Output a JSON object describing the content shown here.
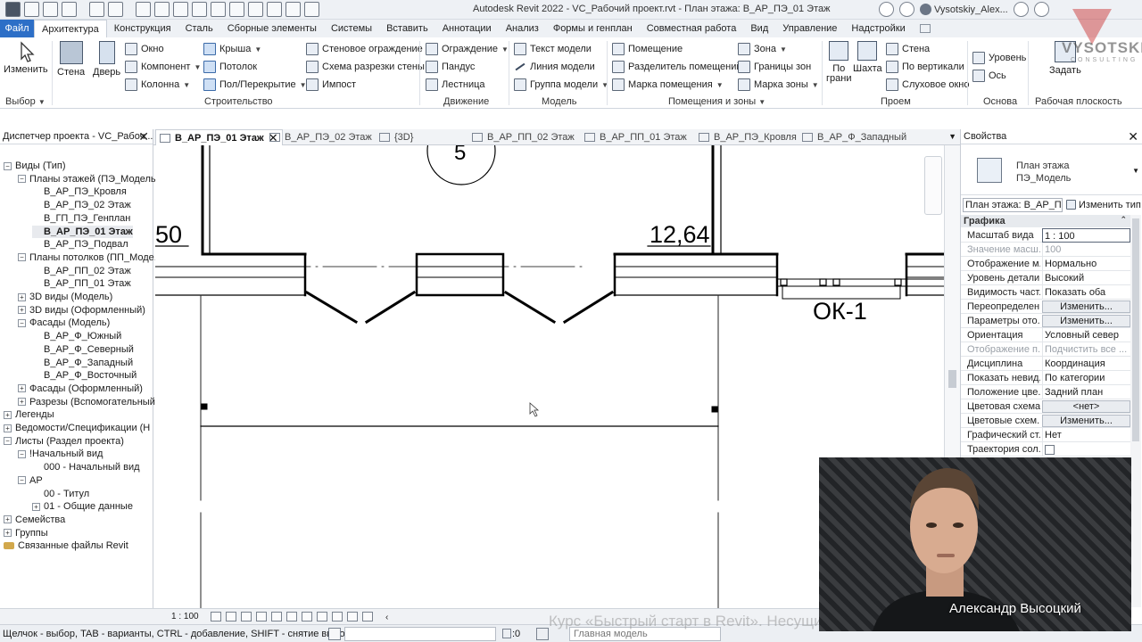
{
  "window": {
    "title": "Autodesk Revit 2022 - VC_Рабочий проект.rvt - План этажа: В_АР_ПЭ_01 Этаж",
    "user": "Vysotskiy_Alex..."
  },
  "tabs": [
    "Файл",
    "Архитектура",
    "Конструкция",
    "Сталь",
    "Сборные элементы",
    "Системы",
    "Вставить",
    "Аннотации",
    "Анализ",
    "Формы и генплан",
    "Совместная работа",
    "Вид",
    "Управление",
    "Надстройки"
  ],
  "ribbon": {
    "select": {
      "modify": "Изменить",
      "label": "Выбор"
    },
    "build": {
      "wall": "Стена",
      "door": "Дверь",
      "window": "Окно",
      "component": "Компонент",
      "column": "Колонна",
      "roof": "Крыша",
      "ceiling": "Потолок",
      "floor": "Пол/Перекрытие",
      "curtain_wall": "Стеновое ограждение",
      "curtain_grid": "Схема разрезки стены",
      "mullion": "Импост",
      "label": "Строительство"
    },
    "circulation": {
      "railing": "Ограждение",
      "ramp": "Пандус",
      "stair": "Лестница",
      "label": "Движение"
    },
    "model": {
      "text": "Текст модели",
      "line": "Линия модели",
      "group": "Группа модели",
      "label": "Модель"
    },
    "room": {
      "room": "Помещение",
      "separator": "Разделитель помещений",
      "tag": "Марка помещения",
      "area": "Зона",
      "boundary": "Границы зон",
      "area_tag": "Марка зоны",
      "label": "Помещения и зоны"
    },
    "opening": {
      "by_face": [
        "По",
        "грани"
      ],
      "shaft": "Шахта",
      "wall": "Стена",
      "vertical": "По вертикали",
      "dormer": "Слуховое окно",
      "label": "Проем"
    },
    "datum": {
      "level": "Уровень",
      "grid": "Ось",
      "label": "Основа"
    },
    "workplane": {
      "set": "Задать",
      "label": "Рабочая плоскость"
    }
  },
  "project_browser": {
    "title": "Диспетчер проекта - VC_Рабоч...",
    "nodes": [
      {
        "label": "Виды (Тип)",
        "toggle": "-",
        "indent": 0
      },
      {
        "label": "Планы этажей (ПЭ_Модель",
        "toggle": "-",
        "indent": 1
      },
      {
        "label": "В_АР_ПЭ_Кровля",
        "toggle": "",
        "indent": 2
      },
      {
        "label": "В_АР_ПЭ_02 Этаж",
        "toggle": "",
        "indent": 2
      },
      {
        "label": "В_ГП_ПЭ_Генплан",
        "toggle": "",
        "indent": 2
      },
      {
        "label": "В_АР_ПЭ_01 Этаж",
        "toggle": "",
        "indent": 2,
        "active": true
      },
      {
        "label": "В_АР_ПЭ_Подвал",
        "toggle": "",
        "indent": 2
      },
      {
        "label": "Планы потолков (ПП_Моде...",
        "toggle": "-",
        "indent": 1
      },
      {
        "label": "В_АР_ПП_02 Этаж",
        "toggle": "",
        "indent": 2
      },
      {
        "label": "В_АР_ПП_01 Этаж",
        "toggle": "",
        "indent": 2
      },
      {
        "label": "3D виды (Модель)",
        "toggle": "+",
        "indent": 1
      },
      {
        "label": "3D виды (Оформленный)",
        "toggle": "+",
        "indent": 1
      },
      {
        "label": "Фасады (Модель)",
        "toggle": "-",
        "indent": 1
      },
      {
        "label": "В_АР_Ф_Южный",
        "toggle": "",
        "indent": 2
      },
      {
        "label": "В_АР_Ф_Северный",
        "toggle": "",
        "indent": 2
      },
      {
        "label": "В_АР_Ф_Западный",
        "toggle": "",
        "indent": 2
      },
      {
        "label": "В_АР_Ф_Восточный",
        "toggle": "",
        "indent": 2
      },
      {
        "label": "Фасады (Оформленный)",
        "toggle": "+",
        "indent": 1
      },
      {
        "label": "Разрезы (Вспомогательный",
        "toggle": "+",
        "indent": 1
      },
      {
        "label": "Легенды",
        "toggle": "+",
        "indent": 0
      },
      {
        "label": "Ведомости/Спецификации (Н",
        "toggle": "+",
        "indent": 0
      },
      {
        "label": "Листы (Раздел проекта)",
        "toggle": "-",
        "indent": 0
      },
      {
        "label": "!Начальный вид",
        "toggle": "-",
        "indent": 1
      },
      {
        "label": "000 - Начальный вид",
        "toggle": "",
        "indent": 2
      },
      {
        "label": "АР",
        "toggle": "-",
        "indent": 1
      },
      {
        "label": "00 - Титул",
        "toggle": "",
        "indent": 2
      },
      {
        "label": "01 - Общие данные",
        "toggle": "+",
        "indent": 2
      },
      {
        "label": "Семейства",
        "toggle": "+",
        "indent": 0
      },
      {
        "label": "Группы",
        "toggle": "+",
        "indent": 0
      },
      {
        "label": "Связанные файлы Revit",
        "toggle": "link",
        "indent": 0
      }
    ]
  },
  "doc_tabs": [
    {
      "label": "В_АР_ПЭ_01 Этаж",
      "active": true
    },
    {
      "label": "В_АР_ПЭ_02 Этаж"
    },
    {
      "label": "{3D}"
    },
    {
      "label": "В_АР_ПП_02 Этаж"
    },
    {
      "label": "В_АР_ПП_01 Этаж"
    },
    {
      "label": "В_АР_ПЭ_Кровля"
    },
    {
      "label": "В_АР_Ф_Западный"
    }
  ],
  "drawing": {
    "dim_left": "50",
    "dim_right": "12,64",
    "window_tag": "ОК-1",
    "grid_bubble": "5"
  },
  "properties": {
    "title": "Свойства",
    "type_line1": "План этажа",
    "type_line2": "ПЭ_Модель",
    "filter": "План этажа: В_АР_ПЭ",
    "edit_type": "Изменить тип",
    "group": "Графика",
    "rows": [
      {
        "name": "Масштаб вида",
        "value": "1 : 100",
        "kind": "input"
      },
      {
        "name": "Значение масш...",
        "value": "100",
        "kind": "dim"
      },
      {
        "name": "Отображение м...",
        "value": "Нормально"
      },
      {
        "name": "Уровень детали...",
        "value": "Высокий"
      },
      {
        "name": "Видимость част...",
        "value": "Показать оба"
      },
      {
        "name": "Переопределен...",
        "value": "Изменить...",
        "kind": "btn"
      },
      {
        "name": "Параметры ото...",
        "value": "Изменить...",
        "kind": "btn"
      },
      {
        "name": "Ориентация",
        "value": "Условный север"
      },
      {
        "name": "Отображение п...",
        "value": "Подчистить все ...",
        "kind": "dim"
      },
      {
        "name": "Дисциплина",
        "value": "Координация"
      },
      {
        "name": "Показать невид...",
        "value": "По категории"
      },
      {
        "name": "Положение цве...",
        "value": "Задний план"
      },
      {
        "name": "Цветовая схема",
        "value": "<нет>",
        "kind": "btn"
      },
      {
        "name": "Цветовые схем...",
        "value": "Изменить...",
        "kind": "btn"
      },
      {
        "name": "Графический ст...",
        "value": "Нет"
      },
      {
        "name": "Траектория сол...",
        "value": "",
        "kind": "check"
      }
    ]
  },
  "view_bar": {
    "scale": "1 : 100"
  },
  "status": {
    "message": "Щелчок - выбор, TAB - варианты, CTRL - добавление, SHIFT - снятие выбора.",
    "count": ":0",
    "model": "Главная модель"
  },
  "overlay": {
    "logo": "VYSOTSKIY",
    "logo_sub": "CONSULTING",
    "course": "Курс «Быстрый старт в Revit». Несущие элементы. Размещение колонн",
    "presenter": "Александр Высоцкий"
  }
}
